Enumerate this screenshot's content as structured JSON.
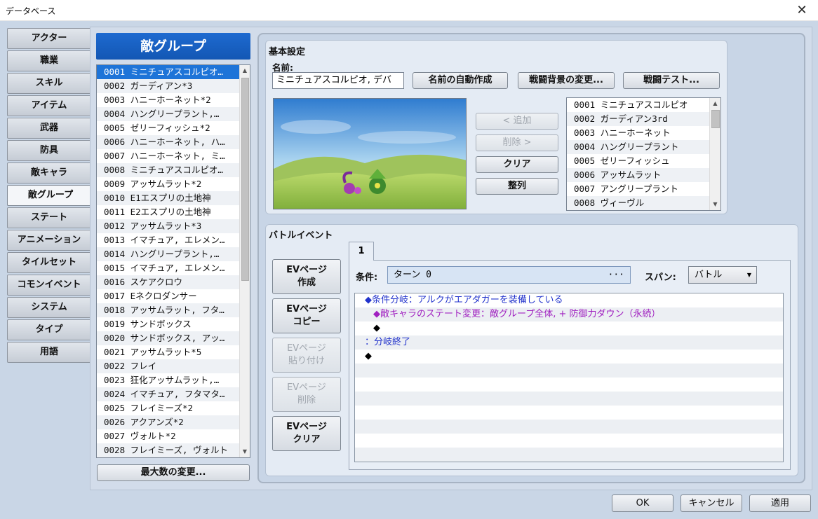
{
  "window": {
    "title": "データベース",
    "close_symbol": "✕"
  },
  "sidebar": {
    "items": [
      "アクター",
      "職業",
      "スキル",
      "アイテム",
      "武器",
      "防具",
      "敵キャラ",
      "敵グループ",
      "ステート",
      "アニメーション",
      "タイルセット",
      "コモンイベント",
      "システム",
      "タイプ",
      "用語"
    ],
    "selected": "敵グループ"
  },
  "troops": {
    "header": "敵グループ",
    "items": [
      "0001 ミニチュアスコルピオ…",
      "0002 ガーディアン*3",
      "0003 ハニーホーネット*2",
      "0004 ハングリープラント,…",
      "0005 ゼリーフィッシュ*2",
      "0006 ハニーホーネット, ハ…",
      "0007 ハニーホーネット, ミ…",
      "0008 ミニチュアスコルピオ…",
      "0009 アッサムラット*2",
      "0010 E1エスプリの土地神",
      "0011 E2エスプリの土地神",
      "0012 アッサムラット*3",
      "0013 イマチュア, エレメン…",
      "0014 ハングリープラント,…",
      "0015 イマチュア, エレメン…",
      "0016 スケアクロウ",
      "0017 Eネクロダンサー",
      "0018 アッサムラット, フタ…",
      "0019 サンドボックス",
      "0020 サンドボックス, アッ…",
      "0021 アッサムラット*5",
      "0022 フレイ",
      "0023 狂化アッサムラット,…",
      "0024 イマチュア, フタマタ…",
      "0025 フレイミーズ*2",
      "0026 アクアンズ*2",
      "0027 ヴォルト*2",
      "0028 フレイミーズ, ヴォルト"
    ],
    "max_button": "最大数の変更..."
  },
  "basic": {
    "title": "基本設定",
    "name_label": "名前:",
    "name_value": "ミニチュアスコルピオ, デバ",
    "btn_autoname": "名前の自動作成",
    "btn_background": "戦闘背景の変更...",
    "btn_test": "戦闘テスト...",
    "btn_add": "< 追加",
    "btn_remove": "削除 >",
    "btn_clear": "クリア",
    "btn_align": "整列",
    "enemies": [
      "0001 ミニチュアスコルピオ",
      "0002 ガーディアン3rd",
      "0003 ハニーホーネット",
      "0004 ハングリープラント",
      "0005 ゼリーフィッシュ",
      "0006 アッサムラット",
      "0007 アングリープラント",
      "0008 ヴィーヴル"
    ]
  },
  "battle_event": {
    "title": "バトルイベント",
    "tab": "1",
    "btn_create": [
      "EVページ",
      "作成"
    ],
    "btn_copy": [
      "EVページ",
      "コピー"
    ],
    "btn_paste": [
      "EVページ",
      "貼り付け"
    ],
    "btn_delete": [
      "EVページ",
      "削除"
    ],
    "btn_clear": [
      "EVページ",
      "クリア"
    ],
    "condition_label": "条件:",
    "condition_value": "ターン 0",
    "span_label": "スパン:",
    "span_value": "バトル",
    "commands": [
      {
        "text": "◆条件分岐：アルクがエアダガーを装備している",
        "color": "#2233cc"
      },
      {
        "text": "◆敵キャラのステート変更：敵グループ全体, + 防御力ダウン（永続）",
        "color": "#a020c0"
      },
      {
        "text": "◆",
        "color": "#000000"
      },
      {
        "text": "：分岐終了",
        "color": "#2233cc"
      },
      {
        "text": "◆",
        "color": "#000000"
      }
    ]
  },
  "footer": {
    "ok": "OK",
    "cancel": "キャンセル",
    "apply": "適用"
  }
}
